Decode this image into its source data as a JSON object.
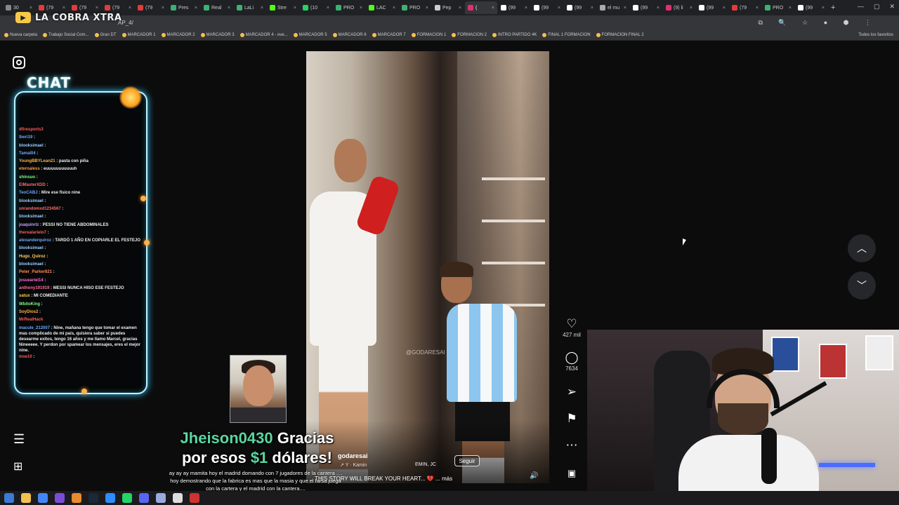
{
  "browser": {
    "tabs": [
      {
        "label": "30",
        "color": "#888888"
      },
      {
        "label": "(79",
        "color": "#e33b3b"
      },
      {
        "label": "(79",
        "color": "#e33b3b"
      },
      {
        "label": "(79",
        "color": "#e33b3b"
      },
      {
        "label": "(79",
        "color": "#e33b3b"
      },
      {
        "label": "Pres",
        "color": "#3bb273"
      },
      {
        "label": "Real",
        "color": "#3bb273"
      },
      {
        "label": "LaLi",
        "color": "#3bb273"
      },
      {
        "label": "Stre",
        "color": "#53fc18"
      },
      {
        "label": "(10",
        "color": "#25d366"
      },
      {
        "label": "PRO",
        "color": "#3bb273"
      },
      {
        "label": "LAC",
        "color": "#53fc18"
      },
      {
        "label": "PRO",
        "color": "#3bb273"
      },
      {
        "label": "Pep",
        "color": "#cccccc"
      },
      {
        "label": "(",
        "color": "#e1306c",
        "active": true
      },
      {
        "label": "(99",
        "color": "#ffffff"
      },
      {
        "label": "(99",
        "color": "#ffffff"
      },
      {
        "label": "(99",
        "color": "#ffffff"
      },
      {
        "label": "el mu",
        "color": "#aaaaaa"
      },
      {
        "label": "(99",
        "color": "#ffffff"
      },
      {
        "label": "(9) li",
        "color": "#e1306c"
      },
      {
        "label": "(99",
        "color": "#ffffff"
      },
      {
        "label": "(79",
        "color": "#e33b3b"
      },
      {
        "label": "PRO",
        "color": "#3bb273"
      },
      {
        "label": "(99",
        "color": "#ffffff"
      }
    ],
    "url": "AP_4/",
    "bookmarks": [
      "Nueva carpeta",
      "Trabajo Social Com...",
      "Gran DT",
      "MARCADOR 1",
      "MARCADOR 2",
      "MARCADOR 3",
      "MARCADOR 4 - ove...",
      "MARCADOR 5",
      "MARCADOR 6",
      "MARCADOR 7",
      "FORMACION 1",
      "FORMACION 2",
      "INTRO PARTIDO 4K",
      "FINAL 1 FORMACION",
      "FORMACION FINAL 2"
    ],
    "bookmarks_right": "Todos los favoritos"
  },
  "overlay": {
    "logo_text": "LA COBRA XTRA",
    "chat_title": "CHAT"
  },
  "chat": [
    {
      "user": "dfiresports3",
      "msg": "",
      "color": "#ff5a5a"
    },
    {
      "user": "lberi19",
      "msg": ":",
      "color": "#6ea8ff"
    },
    {
      "user": "blooksimael",
      "msg": ":",
      "color": "#9cf"
    },
    {
      "user": "Tamal04",
      "msg": ":",
      "color": "#6ea8ff"
    },
    {
      "user": "YoungBBYLean21",
      "msg": ": pasta con piña",
      "color": "#ffb347"
    },
    {
      "user": "eternaless",
      "msg": ": euuuuuuuuuuuh",
      "color": "#ff9a3c"
    },
    {
      "user": "shinsuo",
      "msg": ":",
      "color": "#7fff7f"
    },
    {
      "user": "ElMasterXDD",
      "msg": ":",
      "color": "#ff6b6b"
    },
    {
      "user": "TeoCABJ",
      "msg": ": Mire ese fisico nine",
      "color": "#6ea8ff"
    },
    {
      "user": "blooksimael",
      "msg": ":",
      "color": "#9cf"
    },
    {
      "user": "unrandomxd1234567",
      "msg": ":",
      "color": "#ff6b6b"
    },
    {
      "user": "blooksimael",
      "msg": ":",
      "color": "#9cf"
    },
    {
      "user": "joaquinrlz",
      "msg": ": PESSI NO TIENE ABDOMINALES",
      "color": "#c9a0ff"
    },
    {
      "user": "therealarielo7",
      "msg": ":",
      "color": "#ff5a5a"
    },
    {
      "user": "alexanderquiroz",
      "msg": ": TARDÓ 1 AÑO EN COPIARLE EL FESTEJO",
      "color": "#6ea8ff"
    },
    {
      "user": "blooksimael",
      "msg": ":",
      "color": "#9cf"
    },
    {
      "user": "Hugo_Quiroz",
      "msg": ":",
      "color": "#ffcc66"
    },
    {
      "user": "blooksimael",
      "msg": ":",
      "color": "#9cf"
    },
    {
      "user": "Peter_Parker821",
      "msg": ":",
      "color": "#ff8c5a"
    },
    {
      "user": "josueariel14",
      "msg": ":",
      "color": "#ff6bd6"
    },
    {
      "user": "anthony191919",
      "msg": ": MESSI NUNCA HISO ESE FESTEJO",
      "color": "#ff6b9a"
    },
    {
      "user": "satux",
      "msg": ": MI COMEDIANTE",
      "color": "#ffd24a"
    },
    {
      "user": "WbitoKing",
      "msg": ":",
      "color": "#7fff7f"
    },
    {
      "user": "SoyDios2",
      "msg": ":",
      "color": "#ffb347"
    },
    {
      "user": "MrRealHack",
      "msg": "",
      "color": "#ff5a5a"
    },
    {
      "user": "macule_212007",
      "msg": ": Nine, mañana tengo que tomar el examen mas complicado de mi país, quisiera saber si puedes desearme exitos, tengo 16 años y me llamo Marcel, gracias Nineeeee. Y perdon por spamear los mensajes, eres el mejor nine.",
      "color": "#6ea8ff",
      "wrap": true
    },
    {
      "user": "mse10",
      "msg": ":",
      "color": "#ff5a5a"
    }
  ],
  "video": {
    "watermark": "@GODARESAI",
    "username": "godaresai",
    "sound": "Y · Kamin",
    "tag": "EMIN, JC",
    "follow_label": "Seguir",
    "caption": "THIS STORY WILL BREAK YOUR HEART... 💔 ... más",
    "likes": "427 mil",
    "comments": "7634"
  },
  "donation": {
    "name": "Jheison0430",
    "text_before": "Gracias",
    "text_mid": "por esos",
    "amount": "$1",
    "text_after": "dólares!",
    "message": "ay ay ay mamita hoy el madrid domando con 7 jugadores de la cantera .... hoy demostrando que la fabrica es mas que la masia y que el farsa juega con la cartera y el madrid con la cantera...."
  },
  "colors": {
    "accent_green": "#5bd6a0",
    "chat_border": "#bdf4ff"
  }
}
